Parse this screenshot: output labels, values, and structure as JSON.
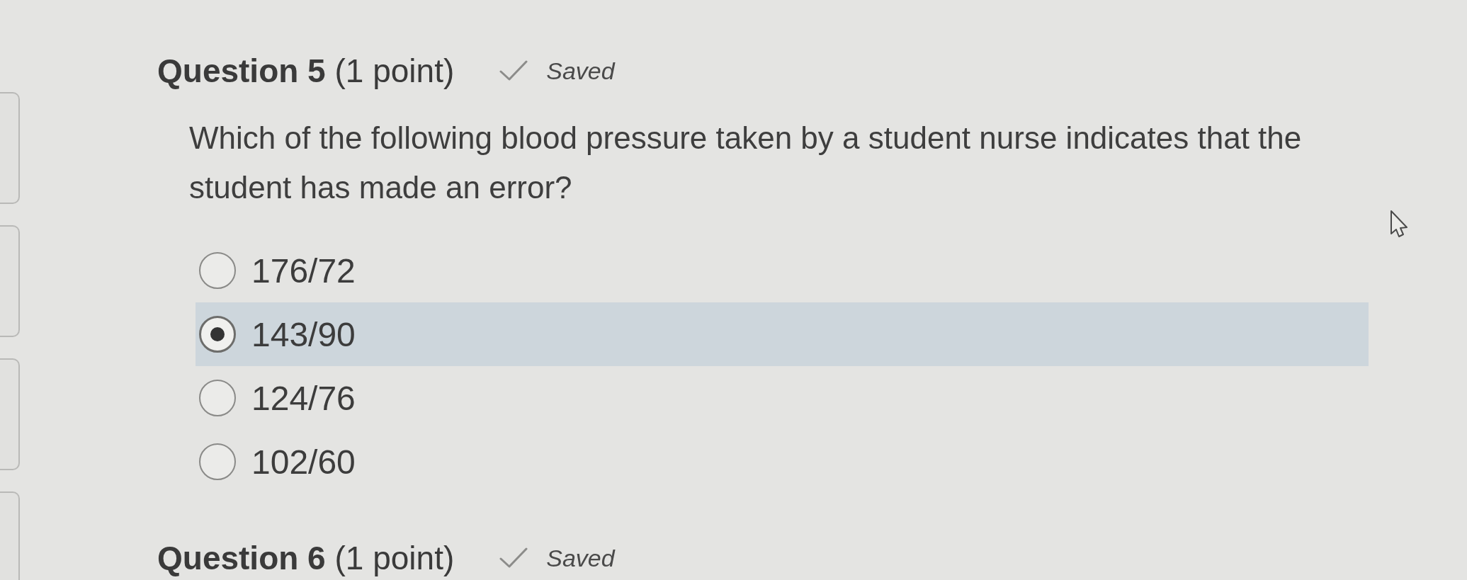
{
  "questions": [
    {
      "heading": "**Question 5** (1 point)",
      "saved": true,
      "status": "Saved",
      "prompt": "Which of the following blood pressure taken by a student nurse indicates that the student has made an error?",
      "options": [
        {
          "label": "176/72",
          "selected": false
        },
        {
          "label": "143/90",
          "selected": true
        },
        {
          "label": "124/76",
          "selected": false
        },
        {
          "label": "102/60",
          "selected": false
        }
      ]
    },
    {
      "heading": "**Question 6** (1 point)",
      "saved": true,
      "status": "Saved"
    }
  ]
}
